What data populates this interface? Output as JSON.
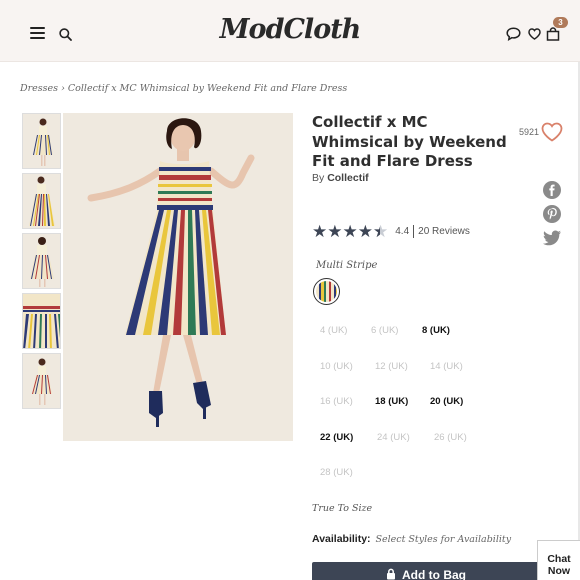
{
  "header": {
    "logo": "ModCloth",
    "cart_count": "3"
  },
  "breadcrumb": {
    "category": "Dresses",
    "separator": "›",
    "current": "Collectif x MC Whimsical by Weekend Fit and Flare Dress"
  },
  "product": {
    "title": "Collectif x MC Whimsical by Weekend Fit and Flare Dress",
    "by_prefix": "By",
    "brand": "Collectif",
    "favorites": "5921",
    "rating": "4.4",
    "reviews": "20 Reviews",
    "rating_value": 4.4,
    "rating_max": 5
  },
  "style": {
    "selected": "Multi Stripe"
  },
  "sizes": [
    {
      "label": "4 (UK)",
      "available": false
    },
    {
      "label": "6 (UK)",
      "available": false
    },
    {
      "label": "8 (UK)",
      "available": true
    },
    {
      "label": "10 (UK)",
      "available": false
    },
    {
      "label": "12 (UK)",
      "available": false
    },
    {
      "label": "14 (UK)",
      "available": false
    },
    {
      "label": "16 (UK)",
      "available": false
    },
    {
      "label": "18 (UK)",
      "available": true
    },
    {
      "label": "20 (UK)",
      "available": true
    },
    {
      "label": "22 (UK)",
      "available": true
    },
    {
      "label": "24 (UK)",
      "available": false
    },
    {
      "label": "26 (UK)",
      "available": false
    },
    {
      "label": "28 (UK)",
      "available": false
    }
  ],
  "fit_note": "True To Size",
  "availability": {
    "label": "Availability:",
    "value": "Select Styles for Availability"
  },
  "add_to_bag": "Add to Bag",
  "chat": {
    "line1": "Chat",
    "line2": "Now"
  },
  "colors": {
    "brand_dark": "#3d4555",
    "heart": "#d9816a",
    "badge": "#b07a5a",
    "header_bg": "#f8f4f2"
  },
  "icons": [
    "menu-icon",
    "search-icon",
    "chat-bubble-icon",
    "heart-icon",
    "bag-icon",
    "facebook-icon",
    "pinterest-icon",
    "twitter-icon",
    "lock-icon"
  ]
}
